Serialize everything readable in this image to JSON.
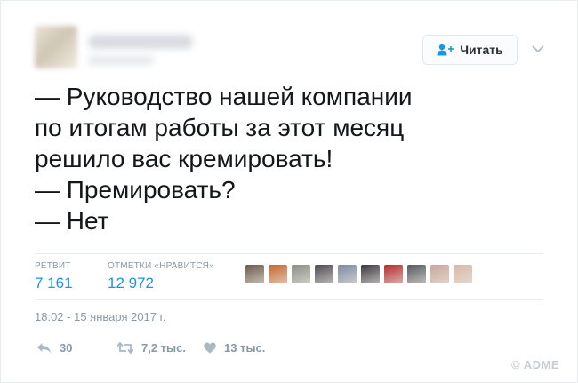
{
  "header": {
    "follow_label": "Читать",
    "follow_icon": "add-user-icon",
    "menu_icon": "chevron-down-icon"
  },
  "tweet": {
    "lines": [
      "— Руководство нашей компании",
      "по итогам работы за этот месяц",
      "решило вас кремировать!",
      "— Премировать?",
      "— Нет"
    ]
  },
  "stats": {
    "retweets_label": "РЕТВИТ",
    "retweets_value": "7 161",
    "likes_label": "ОТМЕТКИ «НРАВИТСЯ»",
    "likes_value": "12 972",
    "liker_colors": [
      "#6b5a4a",
      "#c7652f",
      "#8a8f86",
      "#4d4a52",
      "#7d8aa0",
      "#3a3940",
      "#b42a2a",
      "#55595e",
      "#c9a79a",
      "#d9b8a6"
    ]
  },
  "timestamp": "18:02 - 15 января 2017 г.",
  "actions": {
    "reply_count": "30",
    "retweet_count": "7,2 тыс.",
    "like_count": "13 тыс."
  },
  "watermark": "© ADME",
  "colors": {
    "accent": "#1b95e0",
    "muted": "#8899a6",
    "text": "#14171a"
  }
}
